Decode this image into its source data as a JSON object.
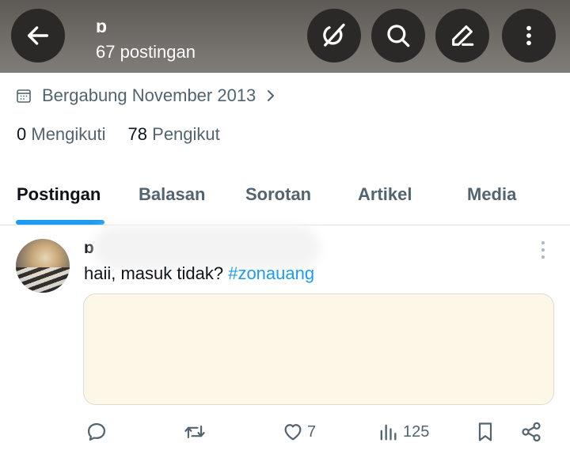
{
  "header": {
    "name": "ɒ",
    "post_count": "67 postingan",
    "bg_color": "#6f6c67",
    "buttons": {
      "back": "arrow-left-icon",
      "grok": "grok-slash-icon",
      "search": "search-icon",
      "compose": "pencil-icon",
      "more": "more-vertical-icon"
    }
  },
  "profile": {
    "joined": "Bergabung November 2013",
    "following_count": "0",
    "following_label": "Mengikuti",
    "followers_count": "78",
    "followers_label": "Pengikut"
  },
  "tabs": [
    {
      "label": "Postingan",
      "active": true
    },
    {
      "label": "Balasan",
      "active": false
    },
    {
      "label": "Sorotan",
      "active": false
    },
    {
      "label": "Artikel",
      "active": false
    },
    {
      "label": "Media",
      "active": false
    }
  ],
  "post": {
    "author_name": "ɒ",
    "text": "haii, masuk tidak? ",
    "hashtag": "#zonauang",
    "stats": {
      "likes": "7",
      "views": "125"
    }
  },
  "colors": {
    "accent": "#1d9bf0",
    "text_primary": "#0f1419",
    "text_secondary": "#536471",
    "media_bg": "#fdf7e7"
  }
}
